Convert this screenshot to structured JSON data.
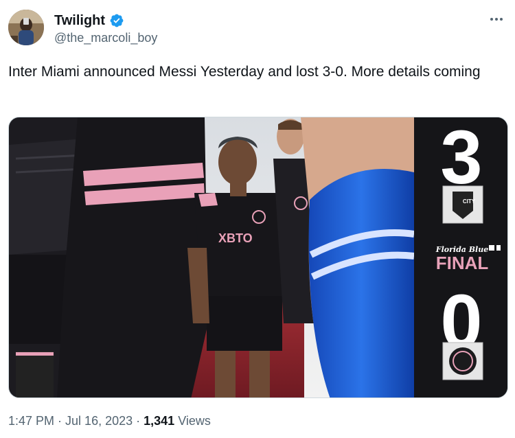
{
  "author": {
    "display_name": "Twilight",
    "handle": "@the_marcoli_boy",
    "verified": true,
    "avatar_icon": "profile-photo-avatar"
  },
  "tweet": {
    "text": "Inter Miami announced Messi Yesterday and lost 3-0. More details coming"
  },
  "media": {
    "kind": "photo",
    "sponsor_text": "XBTO",
    "score_home": "3",
    "score_away": "0",
    "sponsor_banner": "Florida Blue",
    "result_label": "FINAL",
    "home_badge_text": "CITY",
    "colors": {
      "scoreboard_bg": "#151518",
      "final_pink": "#e8a2b9",
      "sock_blue": "#1e64d6",
      "jersey_black": "#17161a",
      "jersey_pink": "#e9a1b8"
    }
  },
  "meta": {
    "time": "1:47 PM",
    "separator": "·",
    "date": "Jul 16, 2023",
    "views_count": "1,341",
    "views_label": "Views"
  },
  "colors": {
    "verified_blue": "#1d9bf0",
    "secondary_text": "#536471"
  }
}
